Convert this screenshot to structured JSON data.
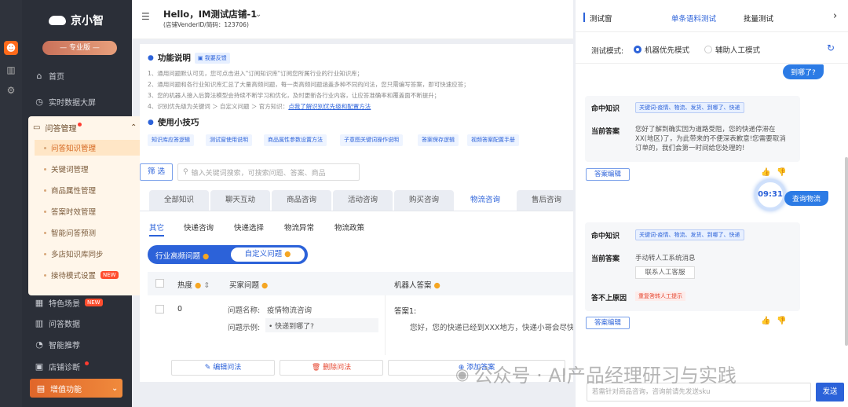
{
  "sidebar": {
    "logo": "京小智",
    "edition": "— 专业版 —",
    "home": "首页",
    "realtime": "实时数据大屏",
    "qa_group": "问答管理",
    "sub_items": [
      "问答知识管理",
      "关键词管理",
      "商品属性管理",
      "答案时效管理",
      "智能问答预测",
      "多店知识库同步",
      "接待模式设置"
    ],
    "new_badge": "NEW",
    "special": "特色场景",
    "qa_data": "问答数据",
    "recommend": "智能推荐",
    "diagnosis": "店铺诊断",
    "addon": "增值功能"
  },
  "header": {
    "title": "Hello，IM测试店铺-1",
    "sub": "(店铺VenderID/简码：123706)"
  },
  "main": {
    "func_title": "功能说明",
    "feedback": "我要反馈",
    "tips": [
      "1、通用问题默认可见，您可点击进入\"订阅知识库\"订阅您所属行业的行业知识库；",
      "2、通用问题和各行业知识库汇总了大量高频问题，每一类高频问题涵盖多种不同的问法，您只需编写答案，即可快速应答；",
      "3、您的机器人接入后算法模型会持续不断学习和优化，及时更新各行业内容，让应答准确率和覆盖面不断提升；",
      "4、识别优先级为关键词 ＞ 自定义问题 ＞ 官方知识："
    ],
    "tips_link": "点我了解识别优先级和配置方法",
    "skill_title": "使用小技巧",
    "skill_chips": [
      "知识库应答逻辑",
      "测试窗使用说明",
      "商品属性参数设置方法",
      "子意图关键词操作说明",
      "答案保存逻辑",
      "视频答案配置手册"
    ],
    "filter": "筛 选",
    "search_placeholder": "输入关键词搜索，可搜索问题、答案、商品",
    "tabs": [
      "全部知识",
      "聊天互动",
      "商品咨询",
      "活动咨询",
      "购买咨询",
      "物流咨询",
      "售后咨询"
    ],
    "sub_tabs": [
      "其它",
      "快递咨询",
      "快递选择",
      "物流异常",
      "物流政策"
    ],
    "toggle_hf": "行业高频问题",
    "toggle_custom": "自定义问题",
    "col_heat": "热度",
    "col_question": "买家问题",
    "col_answer": "机器人答案",
    "row_heat": "0",
    "q_name_label": "问题名称:",
    "q_name": "疫情物流咨询",
    "q_example_label": "问题示例:",
    "q_example": "• 快递到哪了?",
    "answer_label": "答案1:",
    "answer_text": "您好，您的快递已经到XXX地方，快递小哥会尽快派",
    "btn_edit_q": "编辑问法",
    "btn_delete_q": "删除问法",
    "btn_add_a": "添加答案"
  },
  "test_panel": {
    "title": "测试窗",
    "tab_single": "单条语料测试",
    "tab_batch": "批量测试",
    "mode_label": "测试模式:",
    "mode_robot": "机器优先模式",
    "mode_manual": "辅助人工模式",
    "msg1": "到哪了?",
    "hit_label": "命中知识",
    "hit_kw": "关键词-疫情、物流、发货、到哪了、快递",
    "answer_label": "当前答案",
    "answer1": "您好了解到确实因为道路受阻，您的快递停滞在XX(地区)了，为此带来的不便深表歉意!您需要取消订单的，我们会第一时间给您处理的!",
    "edit_answer": "答案编辑",
    "time": "09:31",
    "msg2": "查询物流",
    "hit_kw2": "关键词-疫情、物流、发货、到哪了、快递",
    "answer2": "手动转人工系统消息",
    "contact_btn": "联系人工客服",
    "no_reply_label": "答不上原因",
    "no_reply_reason": "重复答转人工提示",
    "input_placeholder": "若需针对商品咨询，咨询前请先发送sku",
    "send": "发送"
  },
  "watermark": "公众号 · AI产品经理研习与实践"
}
